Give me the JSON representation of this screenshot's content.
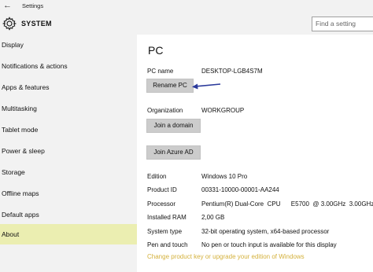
{
  "titlebar": {
    "back_icon": "back-arrow-icon",
    "title": "Settings"
  },
  "header": {
    "icon": "gear-icon",
    "section": "SYSTEM",
    "search_placeholder": "Find a setting"
  },
  "sidebar": {
    "items": [
      {
        "label": "Display"
      },
      {
        "label": "Notifications & actions"
      },
      {
        "label": "Apps & features"
      },
      {
        "label": "Multitasking"
      },
      {
        "label": "Tablet mode"
      },
      {
        "label": "Power & sleep"
      },
      {
        "label": "Storage"
      },
      {
        "label": "Offline maps"
      },
      {
        "label": "Default apps"
      },
      {
        "label": "About",
        "selected": true
      }
    ],
    "selected_color": "#ebeeb1"
  },
  "main": {
    "heading": "PC",
    "pc_name_label": "PC name",
    "pc_name_value": "DESKTOP-LGB4S7M",
    "rename_button": "Rename PC",
    "organization_label": "Organization",
    "organization_value": "WORKGROUP",
    "join_domain_button": "Join a domain",
    "join_azure_button": "Join Azure AD",
    "specs": [
      {
        "label": "Edition",
        "value": "Windows 10 Pro"
      },
      {
        "label": "Product ID",
        "value": "00331-10000-00001-AA244"
      },
      {
        "label": "Processor",
        "value": "Pentium(R) Dual-Core  CPU      E5700  @ 3.00GHz  3.00GHz"
      },
      {
        "label": "Installed RAM",
        "value": "2,00 GB"
      },
      {
        "label": "System type",
        "value": "32-bit operating system, x64-based processor"
      },
      {
        "label": "Pen and touch",
        "value": "No pen or touch input is available for this display"
      }
    ],
    "change_link": "Change product key or upgrade your edition of Windows",
    "link_color": "#d4b13c",
    "annotation_arrow_color": "#2b3a9b"
  }
}
